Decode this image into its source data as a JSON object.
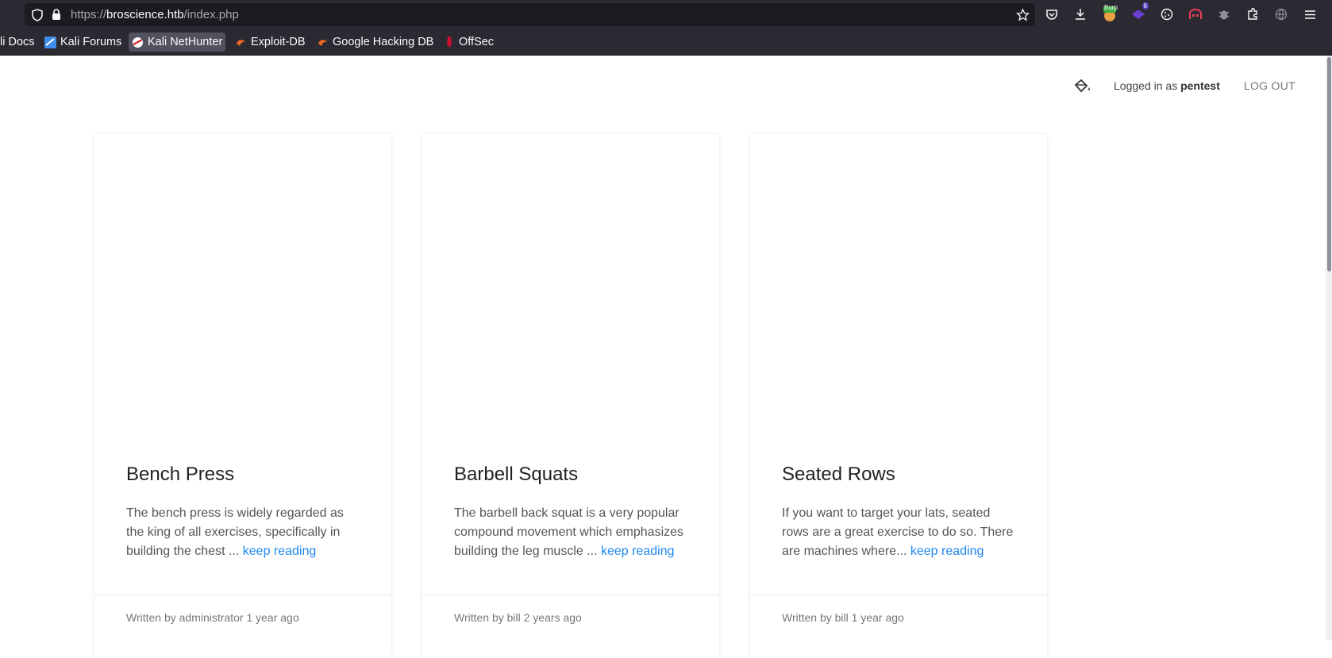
{
  "browser": {
    "url_prefix": "https://",
    "url_host": "broscience.htb",
    "url_path": "/index.php",
    "bookmarks": [
      {
        "label": "li Docs"
      },
      {
        "label": "Kali Forums"
      },
      {
        "label": "Kali NetHunter"
      },
      {
        "label": "Exploit-DB"
      },
      {
        "label": "Google Hacking DB"
      },
      {
        "label": "OffSec"
      }
    ],
    "extension_badges": {
      "burp": "Burp",
      "count": "6"
    }
  },
  "header": {
    "logged_in_prefix": "Logged in as",
    "username": "pentest",
    "logout_label": "LOG OUT"
  },
  "posts": [
    {
      "title": "Bench Press",
      "excerpt": "The bench press is widely regarded as the king of all exercises, specifically in building the chest ...",
      "more_label": "keep reading",
      "meta": "Written by administrator 1 year ago"
    },
    {
      "title": "Barbell Squats",
      "excerpt": "The barbell back squat is a very popular compound movement which emphasizes building the leg muscle ...",
      "more_label": "keep reading",
      "meta": "Written by bill 2 years ago"
    },
    {
      "title": "Seated Rows",
      "excerpt": "If you want to target your lats, seated rows are a great exercise to do so. There are machines where...",
      "more_label": "keep reading",
      "meta": "Written by bill 1 year ago"
    }
  ],
  "colors": {
    "link": "#1e87f0",
    "chrome": "#2b2a33"
  }
}
